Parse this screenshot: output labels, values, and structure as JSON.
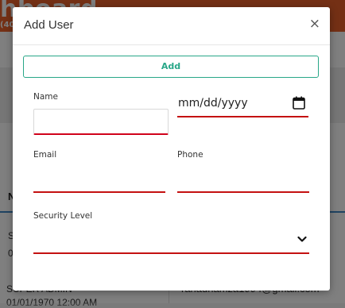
{
  "background": {
    "brand": "hboard",
    "brand_sub": "(40",
    "column_header": "N",
    "cell_a": "S",
    "cell_b": "0",
    "row_role": "SUPER ADMIN",
    "row_email": "rahadhamza1994@gmail.com",
    "row_date": "01/01/1970 12:00 AM"
  },
  "modal": {
    "title": "Add User",
    "close_label": "×",
    "add_button_label": "Add",
    "fields": {
      "name_label": "Name",
      "name_value": "",
      "date_placeholder": "mm/dd/yyyy",
      "email_label": "Email",
      "phone_label": "Phone",
      "security_label": "Security Level",
      "security_value": ""
    }
  },
  "colors": {
    "accent": "#28a788",
    "error_underline": "#c41111",
    "header": "#e8602a"
  },
  "icons": {
    "close": "close-icon",
    "calendar": "calendar-icon",
    "dropdown": "chevron-down-icon"
  }
}
